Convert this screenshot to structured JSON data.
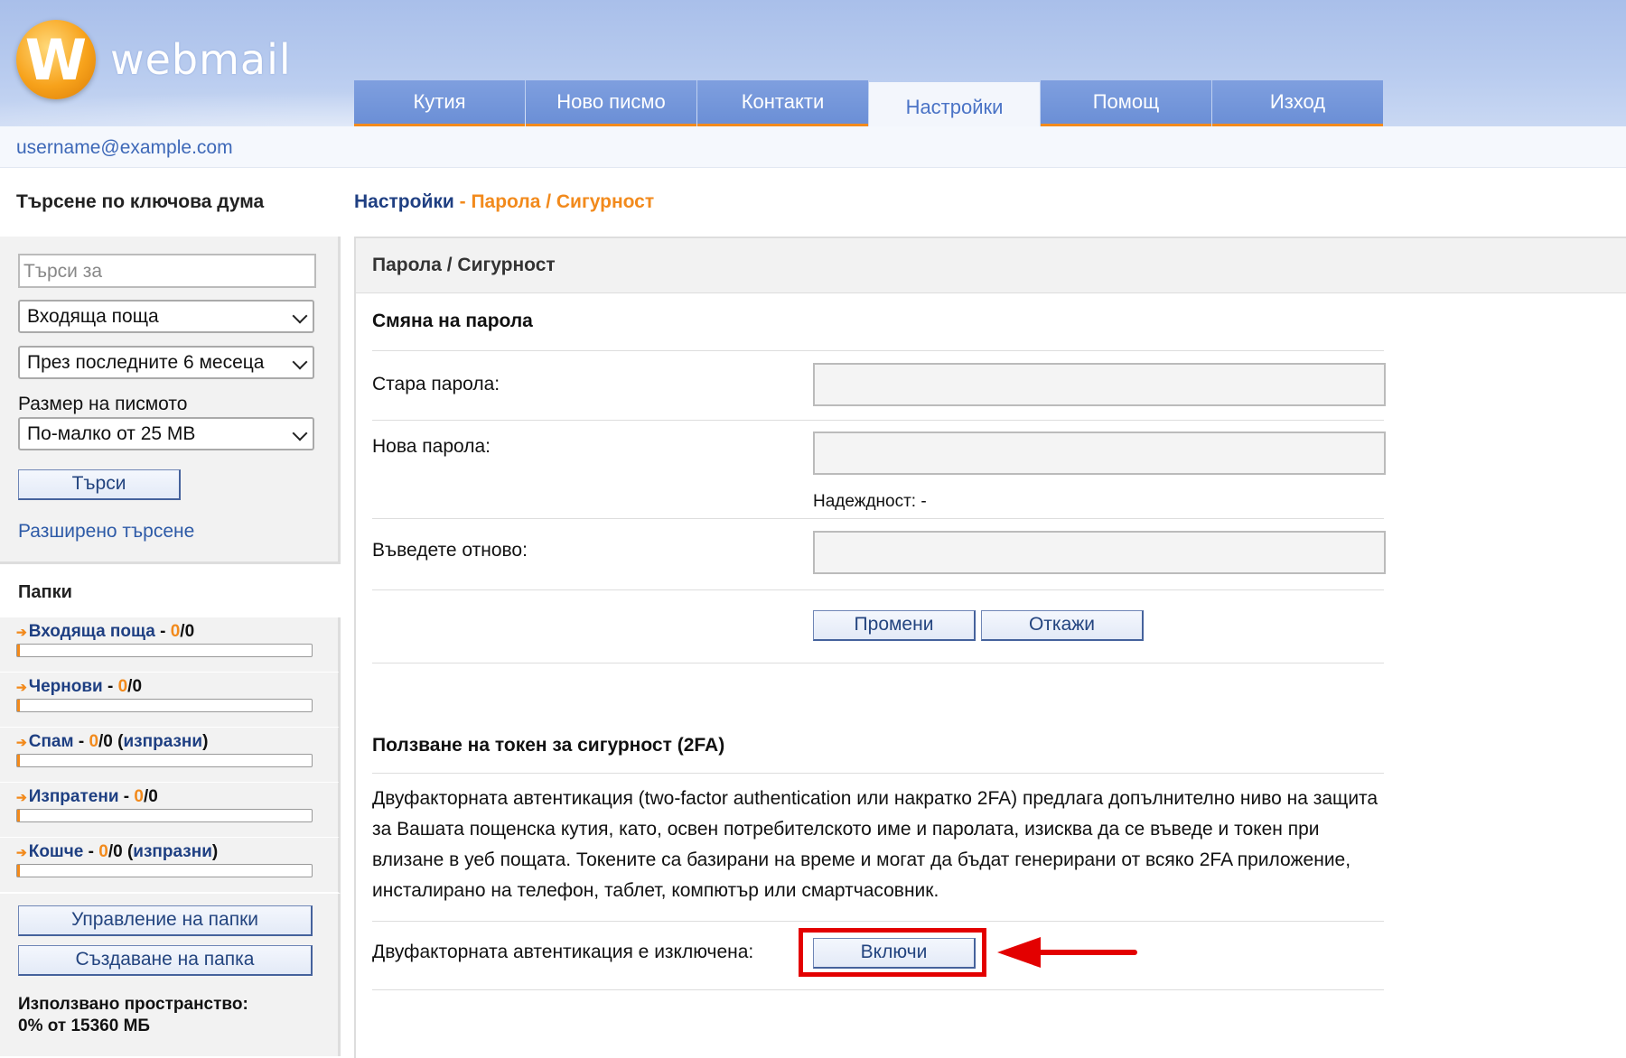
{
  "header": {
    "logo_letter": "W",
    "logo_text": "webmail",
    "tabs": [
      {
        "label": "Кутия",
        "active": false
      },
      {
        "label": "Ново писмо",
        "active": false
      },
      {
        "label": "Контакти",
        "active": false
      },
      {
        "label": "Настройки",
        "active": true
      },
      {
        "label": "Помощ",
        "active": false
      },
      {
        "label": "Изход",
        "active": false
      }
    ]
  },
  "user": {
    "email": "username@example.com"
  },
  "sidebar": {
    "search_title": "Търсене по ключова дума",
    "search_placeholder": "Търси за",
    "folder_select": "Входяща поща",
    "period_select": "През последните 6 месеца",
    "size_label": "Размер на писмото",
    "size_select": "По-малко от 25 MB",
    "search_button": "Търси",
    "advanced_search": "Разширено търсене",
    "folders_title": "Папки",
    "folders": [
      {
        "name": "Входяща поща",
        "sep": " - ",
        "unread": "0",
        "total": "/0",
        "empty": "",
        "usage": 0
      },
      {
        "name": "Чернови",
        "sep": " - ",
        "unread": "0",
        "total": "/0",
        "empty": "",
        "usage": 0
      },
      {
        "name": "Спам",
        "sep": " - ",
        "unread": "0",
        "total": "/0 (",
        "empty": "изпразни",
        "empty_close": ")",
        "usage": 0
      },
      {
        "name": "Изпратени",
        "sep": " - ",
        "unread": "0",
        "total": "/0",
        "empty": "",
        "usage": 0
      },
      {
        "name": "Кошче",
        "sep": " - ",
        "unread": "0",
        "total": "/0 (",
        "empty": "изпразни",
        "empty_close": ")",
        "usage": 0
      }
    ],
    "manage_folders": "Управление на папки",
    "create_folder": "Създаване на папка",
    "space_label": "Използвано пространство:",
    "space_value": "0% от 15360 МБ"
  },
  "main": {
    "crumb_root": "Настройки",
    "crumb_current": " - Парола / Сигурност",
    "panel_title": "Парола / Сигурност",
    "change_password_title": "Смяна на парола",
    "old_password_label": "Стара парола:",
    "new_password_label": "Нова парола:",
    "strength_label": "Надеждност: -",
    "repeat_label": "Въведете отново:",
    "change_button": "Промени",
    "cancel_button": "Откажи",
    "twofa_title": "Ползване на токен за сигурност (2FA)",
    "twofa_text": "Двуфакторната автентикация (two-factor authentication или накратко 2FA) предлага допълнително ниво на защита за Вашата пощенска кутия, като, освен потребителското име и паролата, изисква да се въведе и токен при влизане в уеб пощата. Токените са базирани на време и могат да бъдат генерирани от всяко 2FA приложение, инсталирано на телефон, таблет, компютър или смартчасовник.",
    "twofa_status": "Двуфакторната автентикация е изключена:",
    "enable_button": "Включи"
  },
  "colors": {
    "accent": "#f28a1c",
    "link": "#1e3f82",
    "highlight": "#e30000"
  }
}
